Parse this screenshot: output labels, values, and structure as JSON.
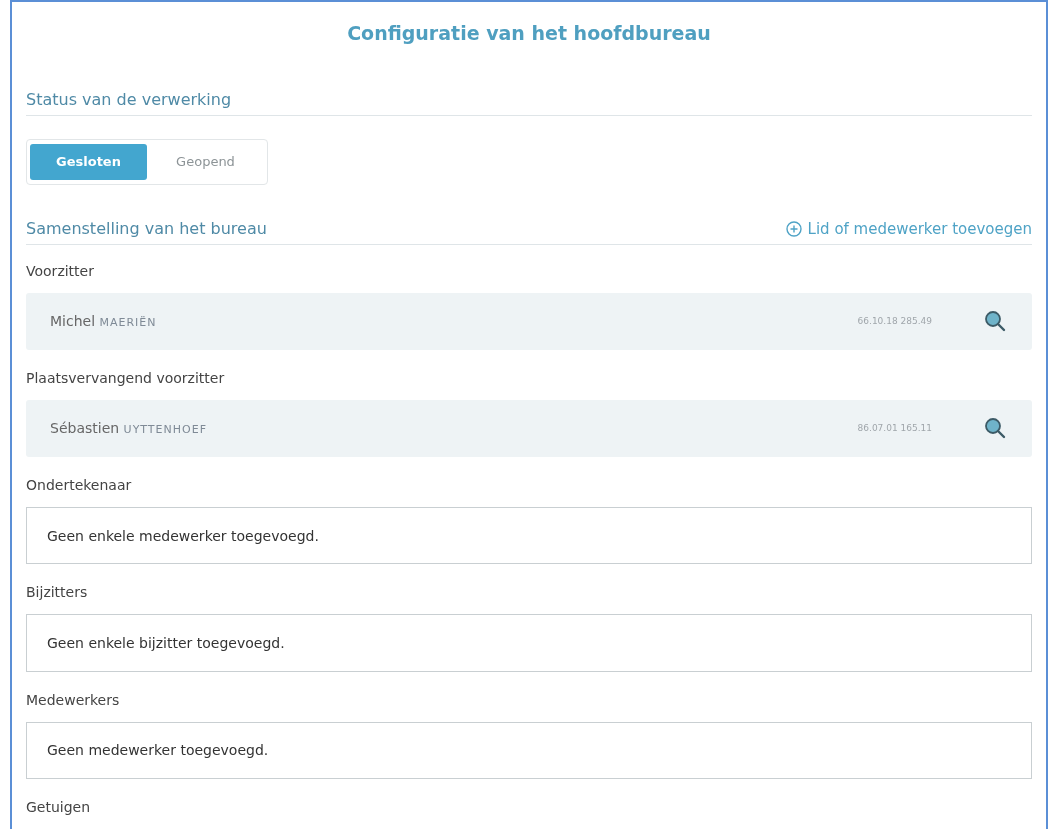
{
  "title": "Configuratie van het hoofdbureau",
  "status": {
    "heading": "Status van de verwerking",
    "options": [
      {
        "label": "Gesloten",
        "selected": true
      },
      {
        "label": "Geopend",
        "selected": false
      }
    ]
  },
  "composition": {
    "heading": "Samenstelling van het bureau",
    "add_link": "Lid of medewerker toevoegen",
    "groups": [
      {
        "label": "Voorzitter",
        "kind": "member",
        "first_name": "Michel",
        "last_name": "MAERIËN",
        "number": "66.10.18 285.49"
      },
      {
        "label": "Plaatsvervangend voorzitter",
        "kind": "member",
        "first_name": "Sébastien",
        "last_name": "UYTTENHOEF",
        "number": "86.07.01 165.11"
      },
      {
        "label": "Ondertekenaar",
        "kind": "empty",
        "message": "Geen enkele medewerker toegevoegd."
      },
      {
        "label": "Bijzitters",
        "kind": "empty",
        "message": "Geen enkele bijzitter toegevoegd."
      },
      {
        "label": "Medewerkers",
        "kind": "empty",
        "message": "Geen medewerker toegevoegd."
      },
      {
        "label": "Getuigen",
        "kind": "label_only"
      }
    ]
  }
}
